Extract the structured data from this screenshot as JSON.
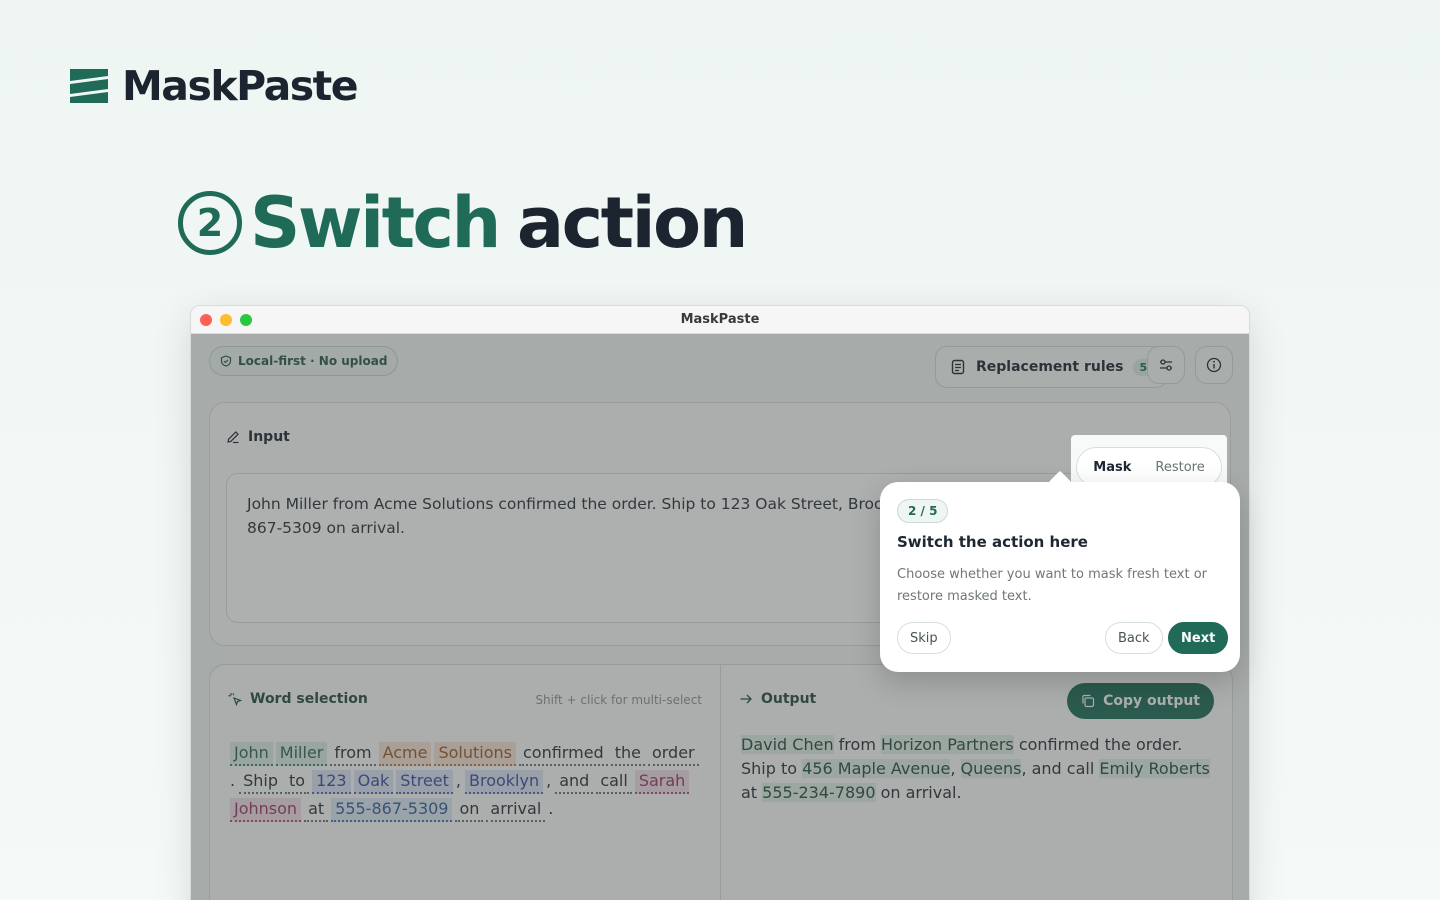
{
  "brand": {
    "name": "MaskPaste",
    "logo_icon": "stripes-logo-icon",
    "accent": "#1f6b58"
  },
  "headline": {
    "step_number": "2",
    "word_green": "Switch",
    "word_dark": "action"
  },
  "window": {
    "title": "MaskPaste"
  },
  "toolbar": {
    "local_badge": "Local-first · No upload",
    "rules_label": "Replacement rules",
    "rules_count": "5",
    "settings_icon": "sliders-icon",
    "info_icon": "info-icon"
  },
  "input": {
    "title": "Input",
    "text": "John Miller from Acme Solutions confirmed the order. Ship to 123 Oak Street, Brooklyn, and call Sarah Johnson at 555-867-5309 on arrival."
  },
  "mode": {
    "active": "Mask",
    "inactive": "Restore"
  },
  "word_selection": {
    "title": "Word selection",
    "hint": "Shift + click for multi-select",
    "tokens": [
      {
        "t": "John",
        "k": "name"
      },
      {
        "t": "Miller",
        "k": "name"
      },
      {
        "t": "from",
        "k": "plain"
      },
      {
        "t": "Acme",
        "k": "org"
      },
      {
        "t": "Solutions",
        "k": "org"
      },
      {
        "t": "confirmed",
        "k": "plain"
      },
      {
        "t": "the",
        "k": "plain"
      },
      {
        "t": "order",
        "k": "plain"
      },
      {
        "t": ".",
        "k": "punct"
      },
      {
        "t": "Ship",
        "k": "plain"
      },
      {
        "t": "to",
        "k": "plain"
      },
      {
        "t": "123",
        "k": "addr"
      },
      {
        "t": "Oak",
        "k": "addr"
      },
      {
        "t": "Street",
        "k": "addr"
      },
      {
        "t": ",",
        "k": "punct"
      },
      {
        "t": "Brooklyn",
        "k": "addr"
      },
      {
        "t": ",",
        "k": "punct"
      },
      {
        "t": "and",
        "k": "plain"
      },
      {
        "t": "call",
        "k": "plain"
      },
      {
        "t": "Sarah",
        "k": "pink"
      },
      {
        "t": "Johnson",
        "k": "pink"
      },
      {
        "t": "at",
        "k": "plain"
      },
      {
        "t": "555-867-5309",
        "k": "phone"
      },
      {
        "t": "on",
        "k": "plain"
      },
      {
        "t": "arrival",
        "k": "plain"
      },
      {
        "t": ".",
        "k": "punct"
      }
    ]
  },
  "output": {
    "title": "Output",
    "copy_label": "Copy output",
    "segments": [
      {
        "t": "David Chen",
        "hl": true
      },
      {
        "t": " from ",
        "hl": false
      },
      {
        "t": "Horizon Partners",
        "hl": true
      },
      {
        "t": " confirmed the order. Ship to ",
        "hl": false
      },
      {
        "t": "456 Maple Avenue",
        "hl": true
      },
      {
        "t": ", ",
        "hl": false
      },
      {
        "t": "Queens",
        "hl": true
      },
      {
        "t": ", and call ",
        "hl": false
      },
      {
        "t": "Emily Roberts",
        "hl": true
      },
      {
        "t": " at ",
        "hl": false
      },
      {
        "t": "555-234-7890",
        "hl": true
      },
      {
        "t": " on arrival.",
        "hl": false
      }
    ]
  },
  "tour": {
    "step": "2 / 5",
    "title": "Switch the action here",
    "description": "Choose whether you want to mask fresh text or restore masked text.",
    "skip": "Skip",
    "back": "Back",
    "next": "Next"
  }
}
